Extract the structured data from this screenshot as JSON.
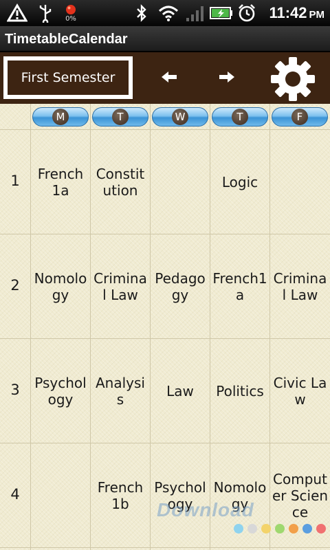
{
  "status_bar": {
    "battery_text": "0%",
    "time": "11:42",
    "ampm": "PM",
    "icons": [
      "warning-icon",
      "usb-icon",
      "battery-alert-icon",
      "bluetooth-icon",
      "wifi-icon",
      "signal-icon",
      "battery-charging-icon",
      "alarm-clock-icon"
    ]
  },
  "app": {
    "title": "TimetableCalendar"
  },
  "toolbar": {
    "semester_label": "First Semester",
    "prev_icon": "arrow-left-icon",
    "next_icon": "arrow-right-icon",
    "settings_icon": "gear-icon"
  },
  "timetable": {
    "days": [
      "M",
      "T",
      "W",
      "T",
      "F"
    ],
    "periods": [
      {
        "label": "1",
        "cells": [
          "French 1a",
          "Constitution",
          "",
          "Logic",
          ""
        ]
      },
      {
        "label": "2",
        "cells": [
          "Nomology",
          "Criminal Law",
          "Pedagogy",
          "French1a",
          "Criminal Law"
        ]
      },
      {
        "label": "3",
        "cells": [
          "Psychology",
          "Analysis",
          "Law",
          "Politics",
          "Civic Law"
        ]
      },
      {
        "label": "4",
        "cells": [
          "",
          "French 1b",
          "Psychology",
          "Nomology",
          "Computer Science"
        ]
      }
    ]
  },
  "watermark": {
    "text": "Download"
  },
  "colors": {
    "toolbar_bg": "#3d2412",
    "grid_bg": "#f0ebd1",
    "day_pill": "#5aa9e6"
  }
}
